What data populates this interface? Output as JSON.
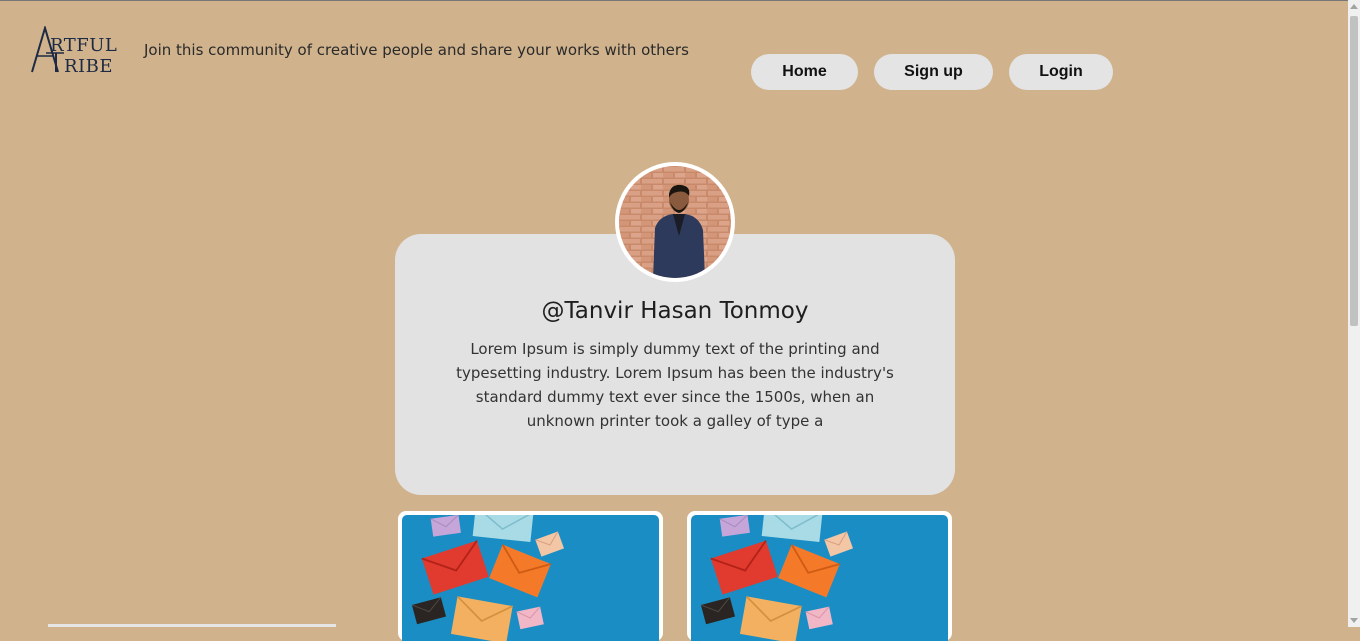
{
  "header": {
    "logo_text": "ARTFUL TRIBE",
    "tagline": "Join this community of creative people and share your works with others"
  },
  "nav": {
    "home": "Home",
    "signup": "Sign up",
    "login": "Login"
  },
  "profile": {
    "username": "@Tanvir Hasan Tonmoy",
    "bio": "Lorem Ipsum is simply dummy text of the printing and typesetting industry. Lorem Ipsum has been the industry's standard dummy text ever since the 1500s, when an unknown printer took a galley of type a"
  },
  "colors": {
    "page_background": "#d0b38d",
    "card_background": "#e2e2e2",
    "button_background": "#e4e4e4"
  },
  "posts": [
    {
      "image": "envelopes-artwork"
    },
    {
      "image": "envelopes-artwork"
    }
  ]
}
